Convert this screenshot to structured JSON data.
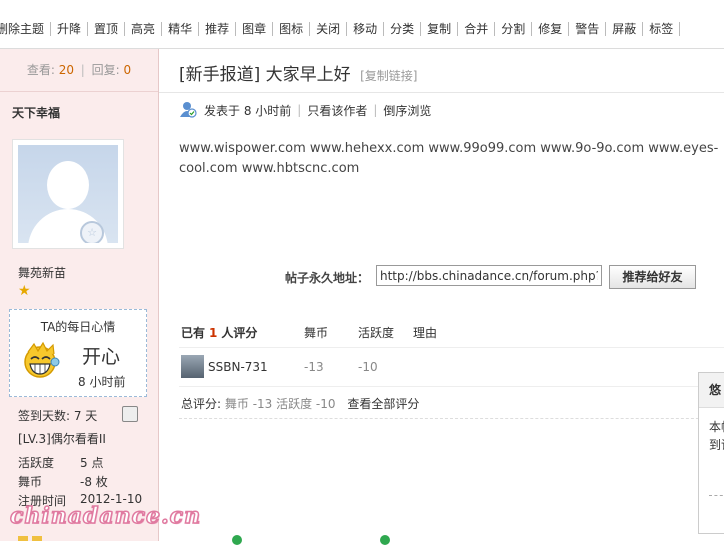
{
  "toolbar": {
    "items": [
      "删除主题",
      "升降",
      "置顶",
      "高亮",
      "精华",
      "推荐",
      "图章",
      "图标",
      "关闭",
      "移动",
      "分类",
      "复制",
      "合并",
      "分割",
      "修复",
      "警告",
      "屏蔽",
      "标签"
    ]
  },
  "sidebar": {
    "views_label": "查看:",
    "views": "20",
    "replies_label": "回复:",
    "replies": "0",
    "username": "天下幸福",
    "group": "舞苑新苗",
    "mood_title": "TA的每日心情",
    "mood": "开心",
    "mood_time": "8 小时前",
    "checkin": "签到天数: 7 天",
    "level": "[LV.3]偶尔看看II",
    "activity_label": "活跃度",
    "activity_value": "5 点",
    "coins_label": "舞币",
    "coins_value": "-8 枚",
    "reg_label": "注册时间",
    "reg_value": "2012-1-10",
    "watermark": "chinadance.cn"
  },
  "post": {
    "title": "[新手报道] 大家早上好",
    "copy_link": "[复制链接]",
    "posted": "发表于 8 小时前",
    "only_author": "只看该作者",
    "reverse": "倒序浏览",
    "content": "www.wispower.com www.hehexx.com  www.99o99.com  www.9o-9o.com www.eyes-cool.com  www.hbtscnc.com",
    "permalink_label": "帖子永久地址：",
    "permalink_value": "http://bbs.chinadance.cn/forum.php?mc",
    "recommend_button": "推荐给好友"
  },
  "rating": {
    "prefix": "已有",
    "count": "1",
    "suffix": "人评分",
    "col_coins": "舞币",
    "col_activity": "活跃度",
    "col_reason": "理由",
    "rater": "SSBN-731",
    "rater_coins": "-13",
    "rater_activity": "-10",
    "total_label": "总评分:",
    "total_values": "舞币 -13  活跃度 -10",
    "view_all": "查看全部评分"
  },
  "popup": {
    "header": "悠",
    "line1": "本帖",
    "line2": "到论"
  },
  "colors": {
    "sidebar_bg": "#fbecec",
    "count_accent": "#cc3300",
    "mood_border": "#9bbad8"
  }
}
